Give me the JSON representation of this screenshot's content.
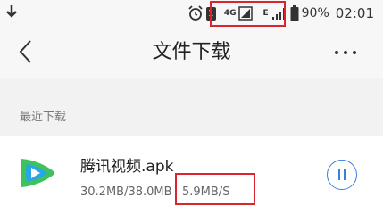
{
  "status_bar": {
    "battery": "90%",
    "time": "02:01",
    "network_4g": "4G",
    "network_e": "E",
    "sim_label": "1"
  },
  "header": {
    "title": "文件下载"
  },
  "section": {
    "label": "最近下载"
  },
  "download": {
    "filename": "腾讯视频.apk",
    "progress_text": "30.2MB/38.0MB",
    "speed": "5.9MB/S",
    "progress": 0.795
  },
  "colors": {
    "highlight_box": "#d9262c",
    "accent": "#3b7fdc",
    "app_icon_green": "#3cc35d",
    "app_icon_blue": "#2aa5e8"
  }
}
